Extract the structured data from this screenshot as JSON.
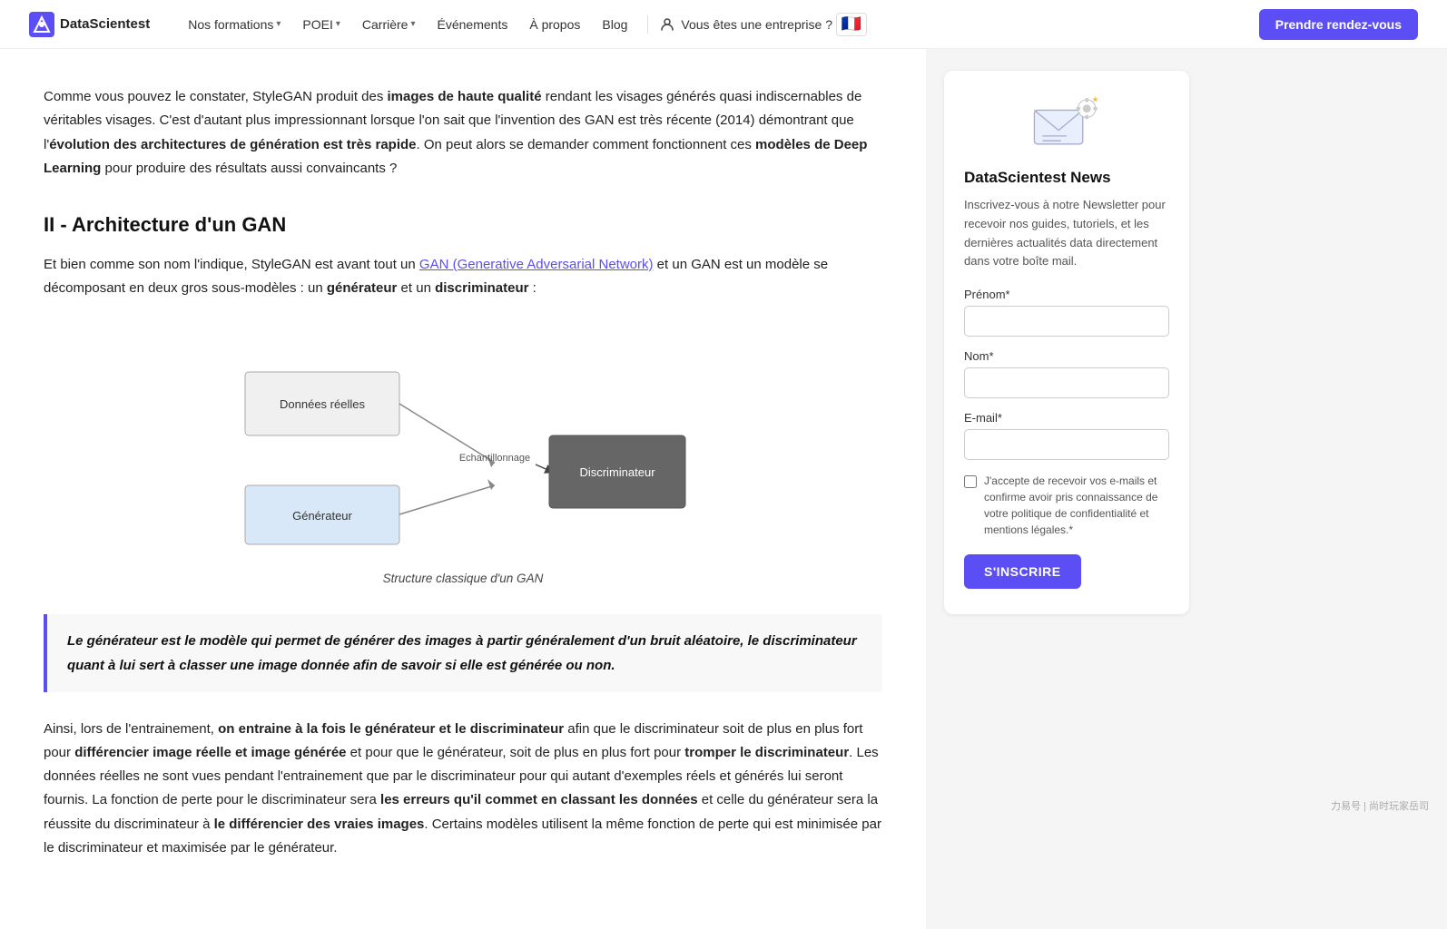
{
  "header": {
    "logo_text": "DataScientest",
    "nav_items": [
      {
        "label": "Nos formations",
        "has_dropdown": true
      },
      {
        "label": "POEI",
        "has_dropdown": true
      },
      {
        "label": "Carrière",
        "has_dropdown": true
      },
      {
        "label": "Événements",
        "has_dropdown": false
      },
      {
        "label": "À propos",
        "has_dropdown": false
      },
      {
        "label": "Blog",
        "has_dropdown": false
      }
    ],
    "enterprise_label": "Vous êtes une entreprise ?",
    "cta_label": "Prendre rendez-vous",
    "flag": "🇫🇷"
  },
  "article": {
    "intro_text_1": "Comme vous pouvez le constater, StyleGAN produit des ",
    "intro_bold_1": "images de haute qualité",
    "intro_text_2": " rendant les visages générés quasi indiscernables de véritables visages. C'est d'autant plus impressionnant lorsque l'on sait que l'invention des GAN est très récente (2014) démontrant que l'",
    "intro_bold_2": "évolution des architectures de génération est très rapide",
    "intro_text_3": ". On peut alors se demander comment fonctionnent ces ",
    "intro_bold_3": "modèles de Deep Learning",
    "intro_text_4": " pour produire des résultats aussi convaincants ?",
    "section_title": "II - Architecture d'un GAN",
    "para1_text_1": "Et bien comme son nom l'indique, StyleGAN est avant tout un ",
    "para1_link_text": "GAN (Generative Adversarial Network)",
    "para1_text_2": " et un GAN est un modèle se décomposant en deux gros sous-modèles : un ",
    "para1_bold_1": "générateur",
    "para1_text_3": " et un ",
    "para1_bold_2": "discriminateur",
    "para1_text_4": " :",
    "diagram_caption": "Structure classique d'un GAN",
    "diagram": {
      "box_donnees": "Données réelles",
      "box_generateur": "Générateur",
      "box_discriminateur": "Discriminateur",
      "label_echantillonnage": "Echantillonnage"
    },
    "blockquote": "Le générateur est le modèle qui permet de générer des images à partir généralement d'un bruit aléatoire, le discriminateur quant à lui sert à classer une image donnée afin de savoir si elle est générée ou non.",
    "para2_text_1": "Ainsi, lors de l'entrainement, ",
    "para2_bold_1": "on entraine à la fois le générateur et le discriminateur",
    "para2_text_2": " afin que le discriminateur soit de plus en plus fort pour ",
    "para2_bold_2": "différencier image réelle et image générée",
    "para2_text_3": " et pour que le générateur, soit de plus en plus fort pour ",
    "para2_bold_3": "tromper le discriminateur",
    "para2_text_4": ". Les données réelles ne sont vues pendant l'entrainement que par le discriminateur pour qui autant d'exemples réels et générés lui seront fournis. La fonction de perte pour le discriminateur sera ",
    "para2_bold_4": "les erreurs qu'il commet en classant les données",
    "para2_text_5": " et celle du générateur sera la réussite du discriminateur à ",
    "para2_bold_5": "le différencier des vraies images",
    "para2_text_6": ". Certains modèles utilisent la même fonction de perte qui est minimisée par le discriminateur et maximisée par le générateur."
  },
  "sidebar": {
    "newsletter_title": "DataScientest News",
    "newsletter_desc": "Inscrivez-vous à notre Newsletter pour recevoir nos guides, tutoriels, et les dernières actualités data directement dans votre boîte mail.",
    "prenom_label": "Prénom*",
    "nom_label": "Nom*",
    "email_label": "E-mail*",
    "prenom_placeholder": "",
    "nom_placeholder": "",
    "email_placeholder": "",
    "checkbox_text": "J'accepte de recevoir vos e-mails et confirme avoir pris connaissance de votre politique de confidentialité et mentions légales.*",
    "subscribe_btn": "S'INSCRIRE"
  },
  "watermark": "力易号 | 尚时玩家岳司"
}
